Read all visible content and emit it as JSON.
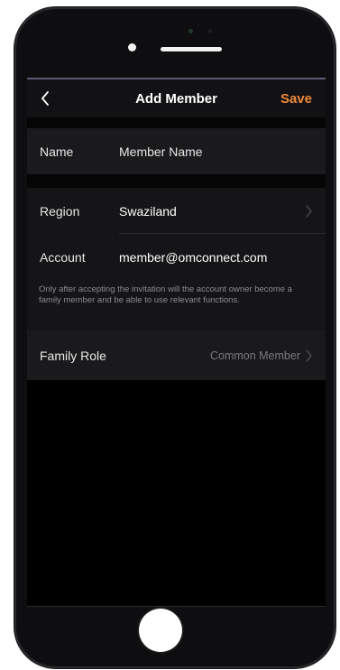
{
  "navbar": {
    "title": "Add Member",
    "save_label": "Save",
    "back_icon": "chevron-left-icon"
  },
  "form": {
    "name": {
      "label": "Name",
      "value": "Member Name"
    },
    "region": {
      "label": "Region",
      "value": "Swaziland"
    },
    "account": {
      "label": "Account",
      "value": "member@omconnect.com"
    },
    "hint": "Only after accepting the invitation will the account owner become a family member and be able to use relevant functions.",
    "family_role": {
      "label": "Family Role",
      "value": "Common Member"
    }
  },
  "colors": {
    "accent": "#f0893a",
    "background": "#000000",
    "row": "#1a1a1c"
  }
}
